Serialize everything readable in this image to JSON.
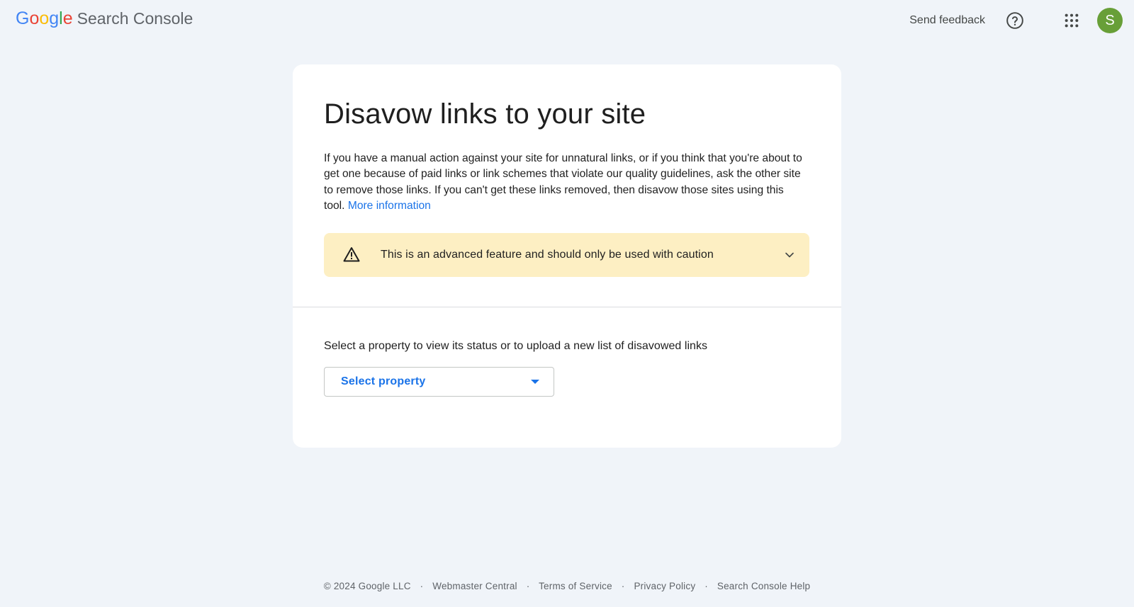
{
  "header": {
    "logo_letters": [
      "G",
      "o",
      "o",
      "g",
      "l",
      "e"
    ],
    "logo_colors": [
      "#4285f4",
      "#ea4335",
      "#fbbc05",
      "#4285f4",
      "#34a853",
      "#ea4335"
    ],
    "product_name": "Search Console",
    "send_feedback": "Send feedback",
    "help_icon": "help-icon",
    "apps_icon": "apps-grid-icon",
    "avatar_initial": "S",
    "avatar_color": "#689f38"
  },
  "card": {
    "title": "Disavow links to your site",
    "description": "If you have a manual action against your site for unnatural links, or if you think that you're about to get one because of paid links or link schemes that violate our quality guidelines, ask the other site to remove those links. If you can't get these links removed, then disavow those sites using this tool.",
    "more_info_link": "More information",
    "warning": {
      "text": "This is an advanced feature and should only be used with caution",
      "icon": "warning-icon",
      "background": "#fdefc3"
    },
    "select_label": "Select a property to view its status or to upload a new list of disavowed links",
    "select_placeholder": "Select property"
  },
  "footer": {
    "copyright": "© 2024 Google LLC",
    "links": [
      "Webmaster Central",
      "Terms of Service",
      "Privacy Policy",
      "Search Console Help"
    ]
  }
}
